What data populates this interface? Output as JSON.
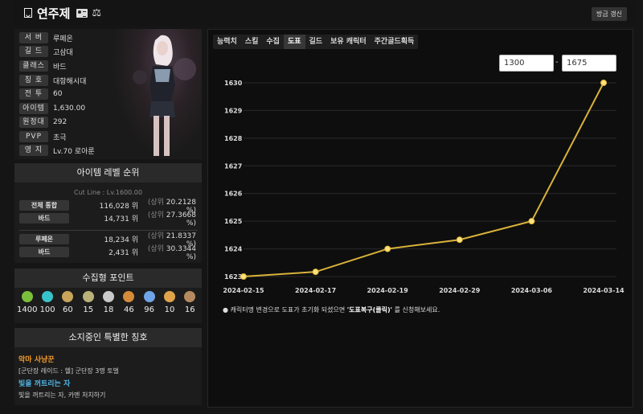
{
  "header": {
    "title": "연주제",
    "scale_glyph": "⚖",
    "refresh_label": "방금 갱신"
  },
  "profile": {
    "rows": [
      {
        "label": "서 버",
        "value": "루페온"
      },
      {
        "label": "길 드",
        "value": "고삼대"
      },
      {
        "label": "클래스",
        "value": "바드"
      },
      {
        "label": "칭 호",
        "value": "대항해시대"
      },
      {
        "label": "전 투",
        "value": "60"
      },
      {
        "label": "아이템",
        "value": "1,630.00"
      },
      {
        "label": "원정대",
        "value": "292"
      },
      {
        "label": "PVP",
        "value": "초극"
      },
      {
        "label": "영 지",
        "value": "Lv.70 로아룬"
      }
    ]
  },
  "ranking": {
    "title": "아이템 레벨 순위",
    "cut_line": "Cut Line : Lv.1600.00",
    "rows": [
      {
        "label": "전체 통합",
        "position": "116,028 위",
        "prefix": "(상위",
        "percent": "20.2128 %)"
      },
      {
        "label": "바드",
        "position": "14,731 위",
        "prefix": "(상위",
        "percent": "27.3668 %)"
      },
      {
        "label": "루페온",
        "position": "18,234 위",
        "prefix": "(상위",
        "percent": "21.8337 %)"
      },
      {
        "label": "바드",
        "position": "2,431 위",
        "prefix": "(상위",
        "percent": "30.3344 %)"
      }
    ]
  },
  "collection": {
    "title": "수집형 포인트",
    "items": [
      {
        "icon": "mokoko-seed-icon",
        "value": "1400",
        "color": "#7bbf3c"
      },
      {
        "icon": "island-soul-icon",
        "value": "100",
        "color": "#38c2c9"
      },
      {
        "icon": "great-art-icon",
        "value": "60",
        "color": "#c7a45a"
      },
      {
        "icon": "giant-heart-icon",
        "value": "15",
        "color": "#b9b07a"
      },
      {
        "icon": "ignea-token-icon",
        "value": "18",
        "color": "#c9c9c9"
      },
      {
        "icon": "voyage-feather-icon",
        "value": "46",
        "color": "#d48b3a"
      },
      {
        "icon": "world-tree-leaf-icon",
        "value": "96",
        "color": "#6fa4e8"
      },
      {
        "icon": "orpheus-star-icon",
        "value": "10",
        "color": "#e0a34a"
      },
      {
        "icon": "omnium-star-icon",
        "value": "16",
        "color": "#b58a5e"
      }
    ]
  },
  "special_titles": {
    "title": "소지중인 특별한 칭호",
    "items": [
      {
        "name": "악마 사냥꾼",
        "desc": "[군단장 레이드 : 헬] 군단장 3명 토벌"
      },
      {
        "name": "빛을 꺼트리는 자",
        "desc": "빛을 꺼트리는 자, 카멘 처치하기"
      }
    ]
  },
  "tabs": {
    "items": [
      "능력치",
      "스킬",
      "수집",
      "도표",
      "길드",
      "보유 캐릭터",
      "주간골드획득"
    ],
    "active": 3
  },
  "range": {
    "min": "1300",
    "separator": "-",
    "max": "1675"
  },
  "chart_data": {
    "type": "line",
    "x": [
      "2024-02-15",
      "2024-02-17",
      "2024-02-19",
      "2024-02-29",
      "2024-03-06",
      "2024-03-14"
    ],
    "y": [
      1623.0,
      1623.17,
      1624.0,
      1624.33,
      1625.0,
      1630.0
    ],
    "y_ticks": [
      "1623",
      "1624",
      "1625",
      "1626",
      "1627",
      "1628",
      "1629",
      "1630"
    ],
    "ylim": [
      1623,
      1630
    ],
    "grid": true,
    "line_color": "#d9b23a",
    "marker_color": "#ffe27a"
  },
  "note": {
    "prefix": "캐릭터명 변경으로 도표가 초기화 되셨으면 ",
    "link": "'도표복구(클릭)'",
    "suffix": " 를 신청해보세요."
  }
}
